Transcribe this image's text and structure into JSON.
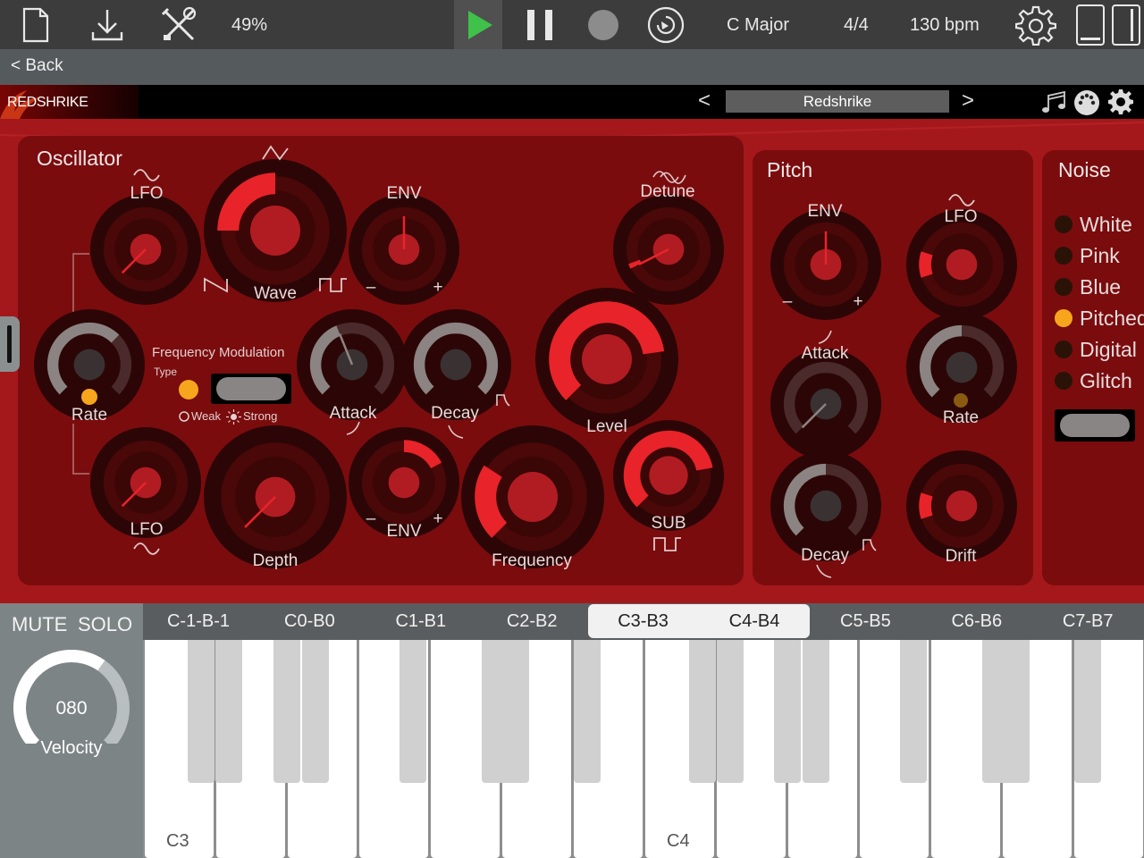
{
  "toolbar": {
    "zoom": "49%",
    "key": "C Major",
    "time_signature": "4/4",
    "tempo": "130 bpm"
  },
  "nav": {
    "back_label": "< Back"
  },
  "plugin": {
    "brand": "REDSHRIKE",
    "preset_name": "Redshrike",
    "prev": "<",
    "next": ">"
  },
  "oscillator": {
    "title": "Oscillator",
    "lfo_top": "LFO",
    "wave": "Wave",
    "env_top": "ENV",
    "detune": "Detune",
    "rate": "Rate",
    "fm_title": "Frequency Modulation",
    "fm_type": "Type",
    "fm_weak": "Weak",
    "fm_strong": "Strong",
    "attack": "Attack",
    "decay": "Decay",
    "level": "Level",
    "lfo_bottom": "LFO",
    "depth": "Depth",
    "env_bottom": "ENV",
    "frequency": "Frequency",
    "sub": "SUB",
    "minus": "–",
    "plus": "+"
  },
  "pitch": {
    "title": "Pitch",
    "env": "ENV",
    "lfo": "LFO",
    "attack": "Attack",
    "rate": "Rate",
    "decay": "Decay",
    "drift": "Drift",
    "minus": "–",
    "plus": "+"
  },
  "noise": {
    "title": "Noise",
    "options": [
      {
        "label": "White",
        "selected": false
      },
      {
        "label": "Pink",
        "selected": false
      },
      {
        "label": "Blue",
        "selected": false
      },
      {
        "label": "Pitched",
        "selected": true
      },
      {
        "label": "Digital",
        "selected": false
      },
      {
        "label": "Glitch",
        "selected": false
      }
    ]
  },
  "keyboard": {
    "mute": "MUTE",
    "solo": "SOLO",
    "velocity_value": "080",
    "velocity_label": "Velocity",
    "velocity_fraction": 0.63,
    "ranges": [
      "C-1-B-1",
      "C0-B0",
      "C1-B1",
      "C2-B2",
      "C3-B3",
      "C4-B4",
      "C5-B5",
      "C6-B6",
      "C7-B7"
    ],
    "selected_ranges": [
      "C3-B3",
      "C4-B4"
    ],
    "key_labels": {
      "c3": "C3",
      "c4": "C4"
    }
  },
  "colors": {
    "accent_red": "#e8232a",
    "body_red": "#a4181b",
    "panel_red": "#7a0c0e",
    "indicator_orange": "#f7a51d",
    "play_green": "#3fc14a"
  }
}
